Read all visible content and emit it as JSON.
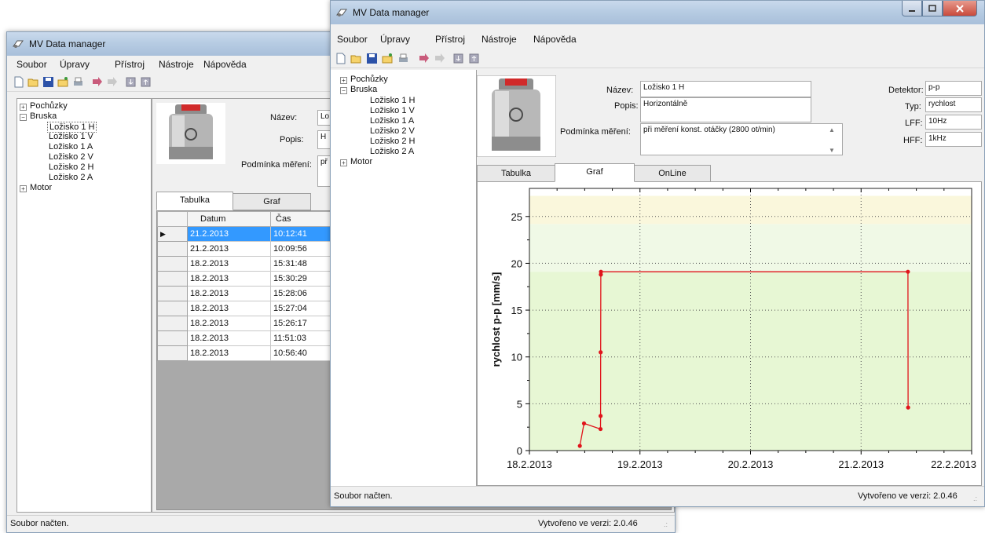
{
  "app": {
    "title": "MV Data manager"
  },
  "menu": {
    "file": "Soubor",
    "edit": "Úpravy",
    "device": "Přístroj",
    "tools": "Nástroje",
    "help": "Nápověda"
  },
  "toolbar_icons": [
    "new-file-icon",
    "open-folder-icon",
    "save-icon",
    "open-file-icon",
    "print-icon",
    "send-icon",
    "receive-icon",
    "download-icon",
    "upload-icon"
  ],
  "tree": {
    "roots": [
      {
        "label": "Pochůzky",
        "state": "collapsed"
      },
      {
        "label": "Bruska",
        "state": "expanded"
      },
      {
        "label": "Motor",
        "state": "collapsed"
      }
    ],
    "children": [
      "Ložisko 1 H",
      "Ložisko 1 V",
      "Ložisko 1 A",
      "Ložisko 2 V",
      "Ložisko 2 H",
      "Ložisko 2 A"
    ],
    "selected": "Ložisko 1 H"
  },
  "details": {
    "name_label": "Název:",
    "name_value": "Ložisko 1 H",
    "desc_label": "Popis:",
    "desc_value": "Horizontálně",
    "desc_value_back": "H",
    "condition_label": "Podmínka měření:",
    "condition_value": "při měření konst. otáčky (2800 ot/min)",
    "condition_value_back": "př",
    "name_value_back": "Lo",
    "detector_label": "Detektor:",
    "detector_value": "p-p",
    "type_label": "Typ:",
    "type_value": "rychlost",
    "lff_label": "LFF:",
    "lff_value": "10Hz",
    "hff_label": "HFF:",
    "hff_value": "1kHz"
  },
  "tabs": {
    "table": "Tabulka",
    "graph": "Graf",
    "online": "OnLine"
  },
  "table": {
    "columns": [
      "Datum",
      "Čas"
    ],
    "rows": [
      [
        "21.2.2013",
        "10:12:41"
      ],
      [
        "21.2.2013",
        "10:09:56"
      ],
      [
        "18.2.2013",
        "15:31:48"
      ],
      [
        "18.2.2013",
        "15:30:29"
      ],
      [
        "18.2.2013",
        "15:28:06"
      ],
      [
        "18.2.2013",
        "15:27:04"
      ],
      [
        "18.2.2013",
        "15:26:17"
      ],
      [
        "18.2.2013",
        "11:51:03"
      ],
      [
        "18.2.2013",
        "10:56:40"
      ]
    ],
    "selected_row": 0
  },
  "status": {
    "left": "Soubor načten.",
    "right": "Vytvořeno ve verzi: 2.0.46"
  },
  "colors": {
    "title_bar": "#b7cce3",
    "selection": "#3399ff",
    "series": "#e0141b",
    "zone_green": "#e7f7d4",
    "zone_light": "#f0f9e6",
    "zone_yellow": "#faf7dc",
    "close_button": "#c94a3b"
  },
  "chart_data": {
    "type": "line",
    "title": "",
    "xlabel": "",
    "ylabel": "rychlost p-p [mm/s]",
    "x_ticks": [
      "18.2.2013",
      "19.2.2013",
      "20.2.2013",
      "21.2.2013",
      "22.2.2013"
    ],
    "y_ticks": [
      0,
      5,
      10,
      15,
      20,
      25
    ],
    "xlim": [
      "18.2.2013 00:00",
      "22.2.2013 00:00"
    ],
    "ylim": [
      0,
      28
    ],
    "grid": true,
    "background_zones": [
      {
        "from": 0,
        "to": 19.1,
        "color": "#e7f7d4"
      },
      {
        "from": 19.1,
        "to": 24.2,
        "color": "#f0f9e6"
      },
      {
        "from": 24.2,
        "to": 27.2,
        "color": "#faf7dc"
      }
    ],
    "series": [
      {
        "color": "#e0141b",
        "points": [
          {
            "x": "18.2.2013 10:56:40",
            "y": 0.5
          },
          {
            "x": "18.2.2013 11:51:03",
            "y": 2.9
          },
          {
            "x": "18.2.2013 15:26:17",
            "y": 2.3
          },
          {
            "x": "18.2.2013 15:27:04",
            "y": 3.7
          },
          {
            "x": "18.2.2013 15:28:06",
            "y": 10.5
          },
          {
            "x": "18.2.2013 15:30:29",
            "y": 18.8
          },
          {
            "x": "18.2.2013 15:31:48",
            "y": 19.1
          },
          {
            "x": "21.2.2013 10:09:56",
            "y": 19.1
          },
          {
            "x": "21.2.2013 10:12:41",
            "y": 4.6
          }
        ]
      }
    ]
  }
}
